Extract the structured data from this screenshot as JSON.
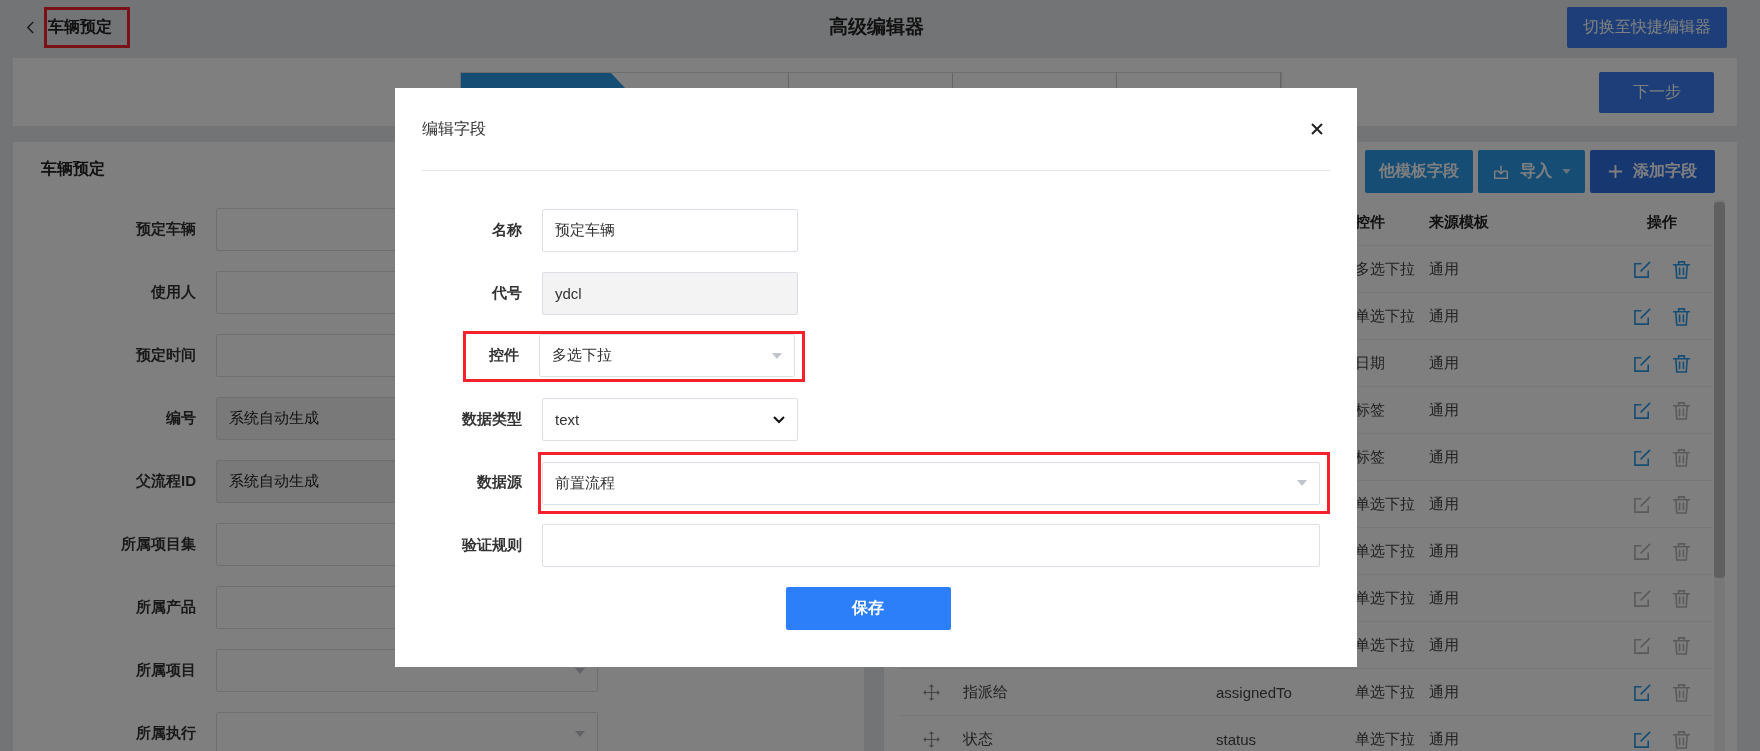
{
  "page_title": {
    "text": "车辆预定",
    "highlighted": true
  },
  "editor_title": "高级编辑器",
  "switch_button": "切换至快捷编辑器",
  "steps": [
    {
      "selected": true
    },
    {
      "selected": false
    },
    {
      "selected": false
    },
    {
      "selected": false
    },
    {
      "selected": false
    }
  ],
  "next_button": "下一步",
  "form_panel": {
    "title": "车辆预定",
    "fields": [
      {
        "label": "预定车辆",
        "kind": "text"
      },
      {
        "label": "使用人",
        "kind": "text"
      },
      {
        "label": "预定时间",
        "kind": "text"
      },
      {
        "label": "编号",
        "kind": "readonly",
        "value": "系统自动生成"
      },
      {
        "label": "父流程ID",
        "kind": "readonly",
        "value": "系统自动生成"
      },
      {
        "label": "所属项目集",
        "kind": "text"
      },
      {
        "label": "所属产品",
        "kind": "text"
      },
      {
        "label": "所属项目",
        "kind": "dropdown"
      },
      {
        "label": "所属执行",
        "kind": "dropdown"
      }
    ]
  },
  "field_panel": {
    "toolbar": [
      {
        "label": "他模板字段",
        "kind": "plain"
      },
      {
        "label": "导入",
        "kind": "import"
      },
      {
        "label": "添加字段",
        "kind": "add"
      }
    ],
    "columns": [
      "控件",
      "来源模板",
      "操作"
    ],
    "rows": [
      {
        "control": "多选下拉",
        "source": "通用",
        "edit_enabled": true,
        "delete_enabled": true
      },
      {
        "control": "单选下拉",
        "source": "通用",
        "edit_enabled": true,
        "delete_enabled": true
      },
      {
        "control": "日期",
        "source": "通用",
        "edit_enabled": true,
        "delete_enabled": true
      },
      {
        "control": "标签",
        "source": "通用",
        "edit_enabled": true,
        "delete_enabled": false
      },
      {
        "control": "标签",
        "source": "通用",
        "edit_enabled": true,
        "delete_enabled": false
      },
      {
        "control": "单选下拉",
        "source": "通用",
        "edit_enabled": false,
        "delete_enabled": false
      },
      {
        "control": "单选下拉",
        "source": "通用",
        "edit_enabled": false,
        "delete_enabled": false
      },
      {
        "control": "单选下拉",
        "source": "通用",
        "edit_enabled": false,
        "delete_enabled": false
      },
      {
        "control": "单选下拉",
        "source": "通用",
        "edit_enabled": false,
        "delete_enabled": false
      },
      {
        "name": "指派给",
        "code": "assignedTo",
        "control": "单选下拉",
        "source": "通用",
        "edit_enabled": true,
        "delete_enabled": false
      },
      {
        "name": "状态",
        "code": "status",
        "control": "单选下拉",
        "source": "通用",
        "edit_enabled": true,
        "delete_enabled": false
      }
    ]
  },
  "dialog": {
    "title": "编辑字段",
    "fields": [
      {
        "label": "名称",
        "kind": "text",
        "value": "预定车辆"
      },
      {
        "label": "代号",
        "kind": "readonly",
        "value": "ydcl"
      },
      {
        "label": "控件",
        "kind": "dropdown",
        "value": "多选下拉",
        "row_highlighted": true
      },
      {
        "label": "数据类型",
        "kind": "select",
        "value": "text"
      },
      {
        "label": "数据源",
        "kind": "dropdown",
        "value": "前置流程",
        "input_highlighted": true,
        "wide": true
      },
      {
        "label": "验证规则",
        "kind": "text",
        "wide": true
      }
    ],
    "save_button": "保存"
  }
}
